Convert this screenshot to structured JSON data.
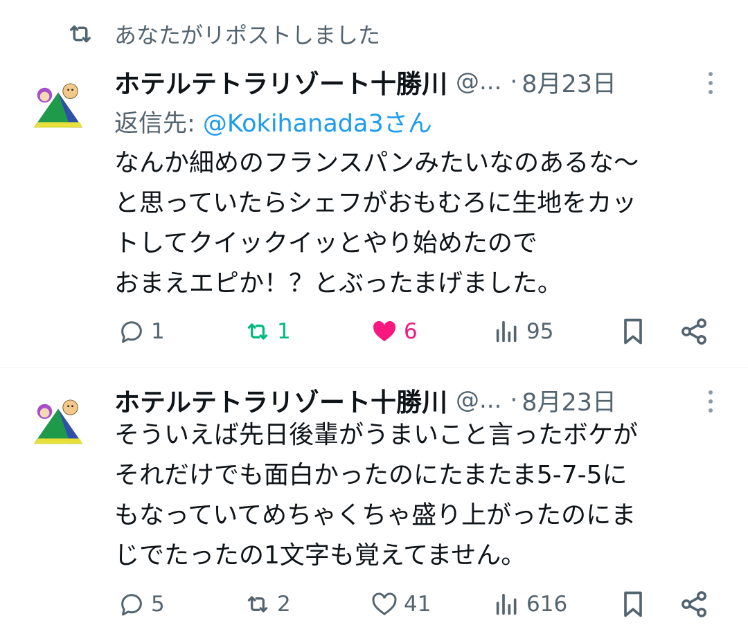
{
  "repost_banner": {
    "text": "あなたがリポストしました",
    "icon": "repost-icon"
  },
  "tweets": [
    {
      "name": "ホテルテトラリゾート十勝川",
      "handle": "@...",
      "dot": "·",
      "date": "8月23日",
      "reply_prefix": "返信先: ",
      "reply_mention": "@Kokihanada3さん",
      "lines": [
        "なんか細めのフランスパンみたいなのあるな〜",
        "と思っていたらシェフがおもむろに生地をカッ",
        "トしてクイックイッとやり始めたので",
        "おまえエピか！？とぶったまげました。"
      ],
      "replies": "1",
      "reposts": "1",
      "likes": "6",
      "views": "95",
      "reposted": true,
      "liked": true
    },
    {
      "name": "ホテルテトラリゾート十勝川",
      "handle": "@...",
      "dot": "·",
      "date": "8月23日",
      "lines": [
        "そういえば先日後輩がうまいこと言ったボケが",
        "それだけでも面白かったのにたまたま5-7-5に",
        "もなっていてめちゃくちゃ盛り上がったのにま",
        "じでたったの1文字も覚えてません。"
      ],
      "replies": "5",
      "reposts": "2",
      "likes": "41",
      "views": "616",
      "reposted": false,
      "liked": false
    }
  ],
  "colors": {
    "text": "#0f1419",
    "secondary": "#536471",
    "link": "#1d9bf0",
    "repost_active": "#00ba7c",
    "like_active": "#f91880",
    "divider": "#eff3f4"
  }
}
